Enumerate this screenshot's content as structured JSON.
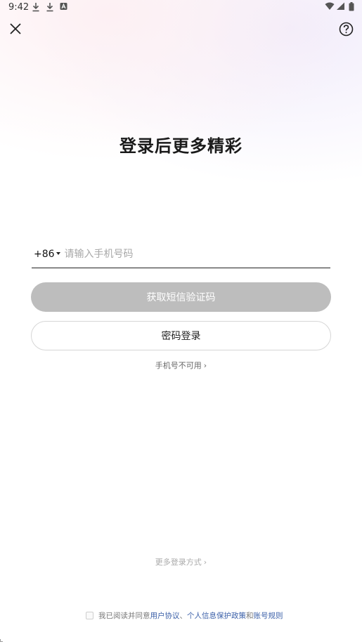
{
  "status_bar": {
    "time": "9:42"
  },
  "header": {
    "title": "登录后更多精彩"
  },
  "phone": {
    "country_code": "+86",
    "placeholder": "请输入手机号码",
    "value": ""
  },
  "buttons": {
    "sms_code": "获取短信验证码",
    "password_login": "密码登录"
  },
  "links": {
    "phone_unavailable": "手机号不可用",
    "more_login": "更多登录方式"
  },
  "agreement": {
    "prefix": "我已阅读并同意",
    "user_agreement": "用户协议",
    "separator": "、",
    "privacy_policy": "个人信息保护政策",
    "and": "和",
    "account_rules": "账号规则",
    "checked": false
  },
  "colors": {
    "link": "#3a5fa8",
    "sms_button_bg": "#bdbdbd"
  },
  "icons": {
    "close": "close-icon",
    "help": "help-circle-icon",
    "download": "download-icon",
    "wifi": "wifi-icon",
    "signal": "signal-icon",
    "battery": "battery-icon"
  }
}
